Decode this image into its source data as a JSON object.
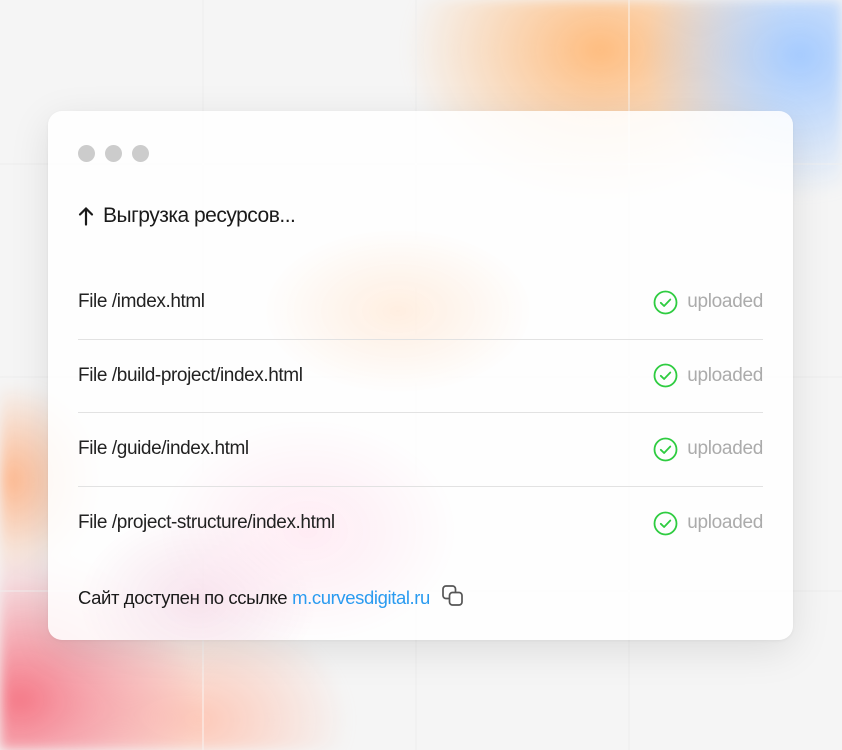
{
  "colors": {
    "accent": "#2a9bf0",
    "success": "#2ecc40",
    "muted": "#ababab",
    "text": "#1a1a1a"
  },
  "window": {
    "traffic_lights": 3,
    "title_icon": "arrow-up-icon",
    "title": "Выгрузка ресурсов..."
  },
  "files": [
    {
      "name": "File /imdex.html",
      "status": "uploaded",
      "status_icon": "check-circle-icon"
    },
    {
      "name": "File /build-project/index.html",
      "status": "uploaded",
      "status_icon": "check-circle-icon"
    },
    {
      "name": "File /guide/index.html",
      "status": "uploaded",
      "status_icon": "check-circle-icon"
    },
    {
      "name": "File /project-structure/index.html",
      "status": "uploaded",
      "status_icon": "check-circle-icon"
    }
  ],
  "footer": {
    "text": "Сайт доступен по ссылке",
    "link": "m.curvesdigital.ru",
    "copy_icon": "copy-icon"
  }
}
